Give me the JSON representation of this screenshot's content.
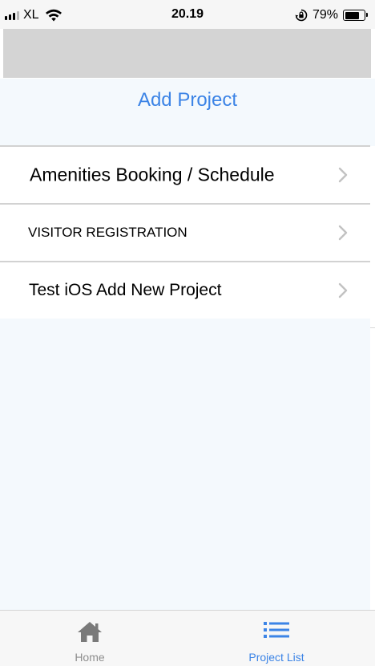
{
  "status_bar": {
    "carrier": "XL",
    "time": "20.19",
    "battery_percent": "79%",
    "battery_level": 0.79,
    "signal_bars_on": 3,
    "icons": [
      "signal-icon",
      "wifi-icon",
      "orientation-lock-icon",
      "battery-icon"
    ]
  },
  "header": {
    "add_project_label": "Add Project"
  },
  "projects": [
    {
      "label": "Amenities Booking / Schedule"
    },
    {
      "label": "VISITOR REGISTRATION"
    },
    {
      "label": "Test iOS Add New Project"
    }
  ],
  "tab_bar": {
    "tabs": [
      {
        "label": "Home",
        "icon": "home-icon",
        "active": false
      },
      {
        "label": "Project List",
        "icon": "list-icon",
        "active": true
      }
    ]
  },
  "colors": {
    "accent": "#3c84e6",
    "inactive_tab": "#8e8e8e",
    "content_background": "#f4f9fd",
    "nav_bar": "#d4d4d4"
  }
}
